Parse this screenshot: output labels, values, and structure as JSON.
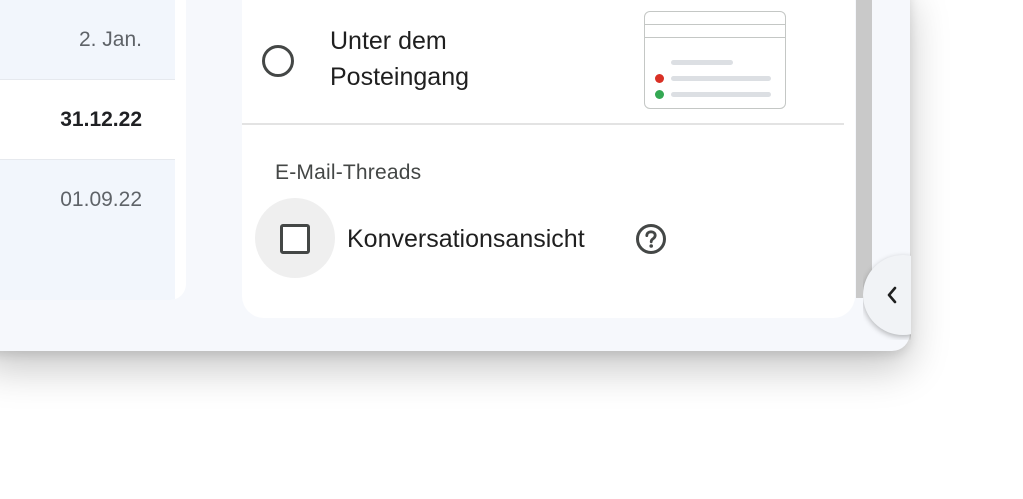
{
  "mail_list": {
    "rows": [
      {
        "date": "2. Jan.",
        "state": "read"
      },
      {
        "date": "31.12.22",
        "state": "unread"
      },
      {
        "date": "01.09.22",
        "state": "read"
      }
    ]
  },
  "settings": {
    "inbox_option": {
      "label": "Unter dem Posteingang",
      "selected": false
    },
    "threads_section": {
      "title": "E-Mail-Threads",
      "conversation_view": {
        "label": "Konversationsansicht",
        "checked": false
      }
    }
  },
  "icons": {
    "help": "question-circle-icon",
    "side_toggle": "chevron-left-icon"
  },
  "colors": {
    "dot_red": "#d93025",
    "dot_green": "#34a853",
    "read_row_bg": "#f2f6fc"
  }
}
